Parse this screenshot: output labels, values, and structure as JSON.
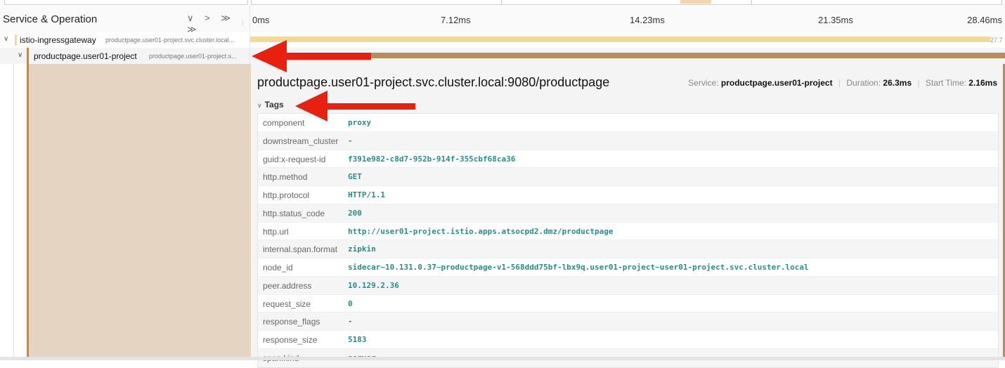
{
  "header": {
    "title": "Service & Operation",
    "controls": "∨ > ≫ ≫",
    "ticks": [
      "0ms",
      "7.12ms",
      "14.23ms",
      "21.35ms",
      "28.46ms"
    ]
  },
  "spans": [
    {
      "service": "istio-ingressgateway",
      "operation": "productpage.user01-project.svc.cluster.local...",
      "bar_label": "27.7",
      "bar_start_fraction": 0.0,
      "bar_width_fraction": 0.98,
      "color": "#f5d896"
    },
    {
      "service": "productpage.user01-project",
      "operation": "productpage.user01-project.s...",
      "bar_start_fraction": 0.076,
      "bar_width_fraction": 0.924,
      "color": "#b88b5d"
    }
  ],
  "detail": {
    "title": "productpage.user01-project.svc.cluster.local:9080/productpage",
    "service_label": "Service:",
    "service_value": "productpage.user01-project",
    "duration_label": "Duration:",
    "duration_value": "26.3ms",
    "start_label": "Start Time:",
    "start_value": "2.16ms",
    "tags_label": "Tags",
    "tags": [
      {
        "key": "component",
        "value": "proxy"
      },
      {
        "key": "downstream_cluster",
        "value": "-"
      },
      {
        "key": "guid:x-request-id",
        "value": "f391e982-c8d7-952b-914f-355cbf68ca36"
      },
      {
        "key": "http.method",
        "value": "GET"
      },
      {
        "key": "http.protocol",
        "value": "HTTP/1.1"
      },
      {
        "key": "http.status_code",
        "value": "200"
      },
      {
        "key": "http.url",
        "value": "http://user01-project.istio.apps.atsocpd2.dmz/productpage"
      },
      {
        "key": "internal.span.format",
        "value": "zipkin"
      },
      {
        "key": "node_id",
        "value": "sidecar~10.131.0.37~productpage-v1-568ddd75bf-lbx9q.user01-project~user01-project.svc.cluster.local"
      },
      {
        "key": "peer.address",
        "value": "10.129.2.36"
      },
      {
        "key": "request_size",
        "value": "0"
      },
      {
        "key": "response_flags",
        "value": "-"
      },
      {
        "key": "response_size",
        "value": "5183"
      },
      {
        "key": "span.kind",
        "value": "server"
      }
    ]
  },
  "colors": {
    "span_color_selected": "#b88b5d",
    "span_color_parent": "#f5d896",
    "annotation_arrow": "#e8200f",
    "tag_value": "#2a8b8b"
  }
}
